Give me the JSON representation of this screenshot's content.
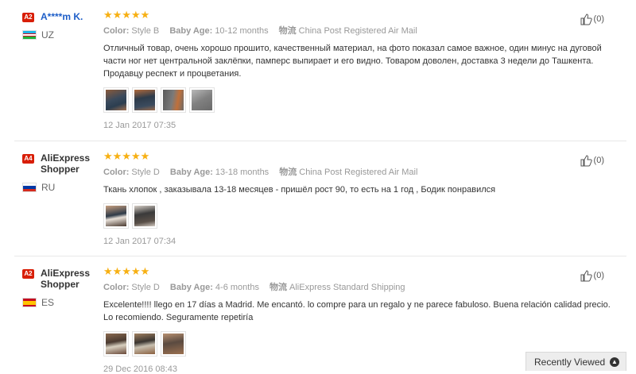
{
  "reviews": [
    {
      "level": "A2",
      "name": "A****m K.",
      "country": "UZ",
      "stars": "★★★★★",
      "color_label": "Color:",
      "color_value": "Style B",
      "size_label": "Baby Age:",
      "size_value": "10-12 months",
      "ship_label": "物流",
      "ship_value": "China Post Registered Air Mail",
      "text": "Отличный товар, очень хорошо прошито, качественный материал, на фото показал самое важное, один минус на дуговой части ног нет центральной заклёпки, памперс выпирает и его видно. Товаром доволен, доставка 3 недели до Ташкента. Продавцу респект и процветания.",
      "date": "12 Jan 2017 07:35",
      "helpful": "(0)"
    },
    {
      "level": "A4",
      "name": "AliExpress Shopper",
      "country": "RU",
      "stars": "★★★★★",
      "color_label": "Color:",
      "color_value": "Style D",
      "size_label": "Baby Age:",
      "size_value": "13-18 months",
      "ship_label": "物流",
      "ship_value": "China Post Registered Air Mail",
      "text": "Ткань хлопок , заказывала 13-18 месяцев - пришёл рост 90, то есть на 1 год , Бодик понравился",
      "date": "12 Jan 2017 07:34",
      "helpful": "(0)"
    },
    {
      "level": "A2",
      "name": "AliExpress Shopper",
      "country": "ES",
      "stars": "★★★★★",
      "color_label": "Color:",
      "color_value": "Style D",
      "size_label": "Baby Age:",
      "size_value": "4-6 months",
      "ship_label": "物流",
      "ship_value": "AliExpress Standard Shipping",
      "text": "Excelente!!!! llego en 17 días a Madrid. Me encantó. lo compre para un regalo y ne parece fabuloso. Buena relación calidad precio. Lo recomiendo. Seguramente repetiría",
      "date": "29 Dec 2016 08:43",
      "helpful": "(0)"
    }
  ],
  "recently_viewed": "Recently Viewed",
  "colors": {
    "star": "#f7b013",
    "level_badge": "#d81e06",
    "username": "#1e5ec8"
  },
  "icons": [
    "thumbs-up-icon",
    "chevron-up-icon"
  ]
}
